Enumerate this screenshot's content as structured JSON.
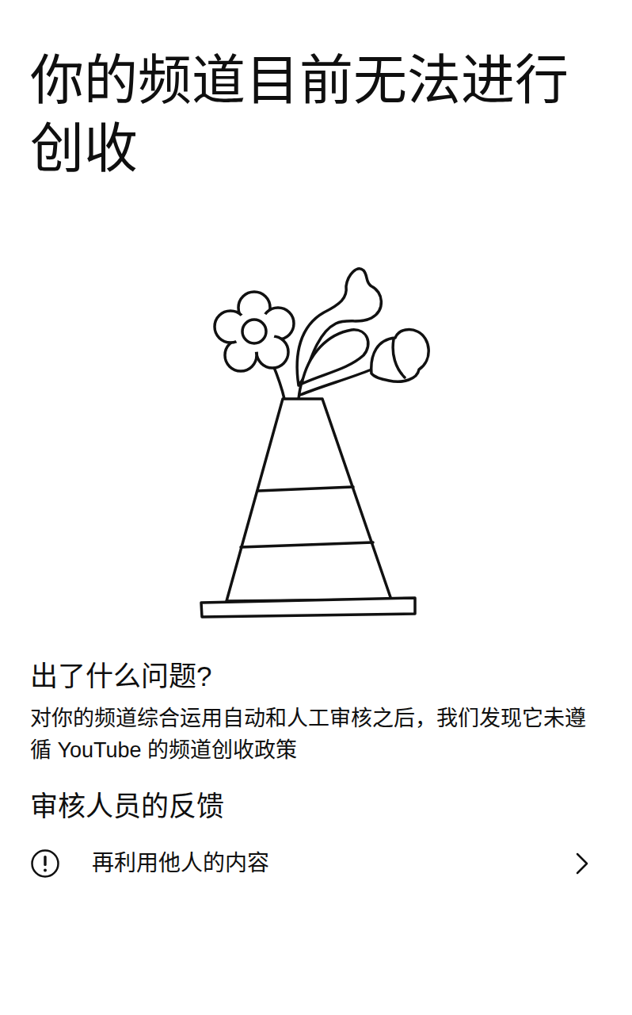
{
  "title": "你的频道目前无法进行创收",
  "issue": {
    "heading": "出了什么问题?",
    "text": "对你的频道综合运用自动和人工审核之后，我们发现它未遵循 YouTube 的频道创收政策"
  },
  "feedback": {
    "heading": "审核人员的反馈",
    "items": [
      {
        "label": "再利用他人的内容"
      }
    ]
  }
}
